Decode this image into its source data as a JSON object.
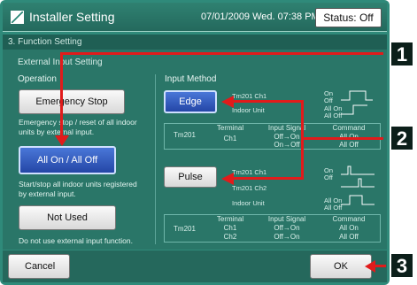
{
  "header": {
    "title": "Installer Setting",
    "datetime": "07/01/2009 Wed. 07:38 PM",
    "status": "Status: Off"
  },
  "breadcrumb": "3. Function Setting",
  "section": "External Input Setting",
  "operation": {
    "label": "Operation",
    "buttons": [
      {
        "label": "Emergency Stop",
        "desc": "Emergency stop / reset of all indoor units by external input."
      },
      {
        "label": "All On / All Off",
        "desc": "Start/stop all indoor units registered by external input."
      },
      {
        "label": "Not Used",
        "desc": "Do not use external input function."
      }
    ]
  },
  "input": {
    "label": "Input Method",
    "edge": "Edge",
    "pulse": "Pulse",
    "edge_diagram": {
      "ch_label": "Tm201 Ch1",
      "indoor": "Indoor Unit",
      "on": "On",
      "off": "Off",
      "allon": "All On",
      "alloff": "All Off"
    },
    "pulse_diagram": {
      "ch1": "Tm201 Ch1",
      "ch2": "Tm201 Ch2",
      "indoor": "Indoor Unit",
      "on": "On",
      "off": "Off",
      "allon": "All On",
      "alloff": "All Off"
    },
    "edge_table": {
      "headers": [
        "Terminal",
        "Input Signal",
        "Command"
      ],
      "tm": "Tm201",
      "rows": [
        [
          "Ch1",
          "Off→On",
          "All On"
        ],
        [
          "",
          "On→Off",
          "All Off"
        ]
      ]
    },
    "pulse_table": {
      "headers": [
        "Terminal",
        "Input Signal",
        "Command"
      ],
      "tm": "Tm201",
      "rows": [
        [
          "Ch1",
          "Off→On",
          "All On"
        ],
        [
          "Ch2",
          "Off→On",
          "All Off"
        ]
      ]
    }
  },
  "footer": {
    "cancel": "Cancel",
    "ok": "OK"
  },
  "callouts": [
    "1",
    "2",
    "3"
  ]
}
